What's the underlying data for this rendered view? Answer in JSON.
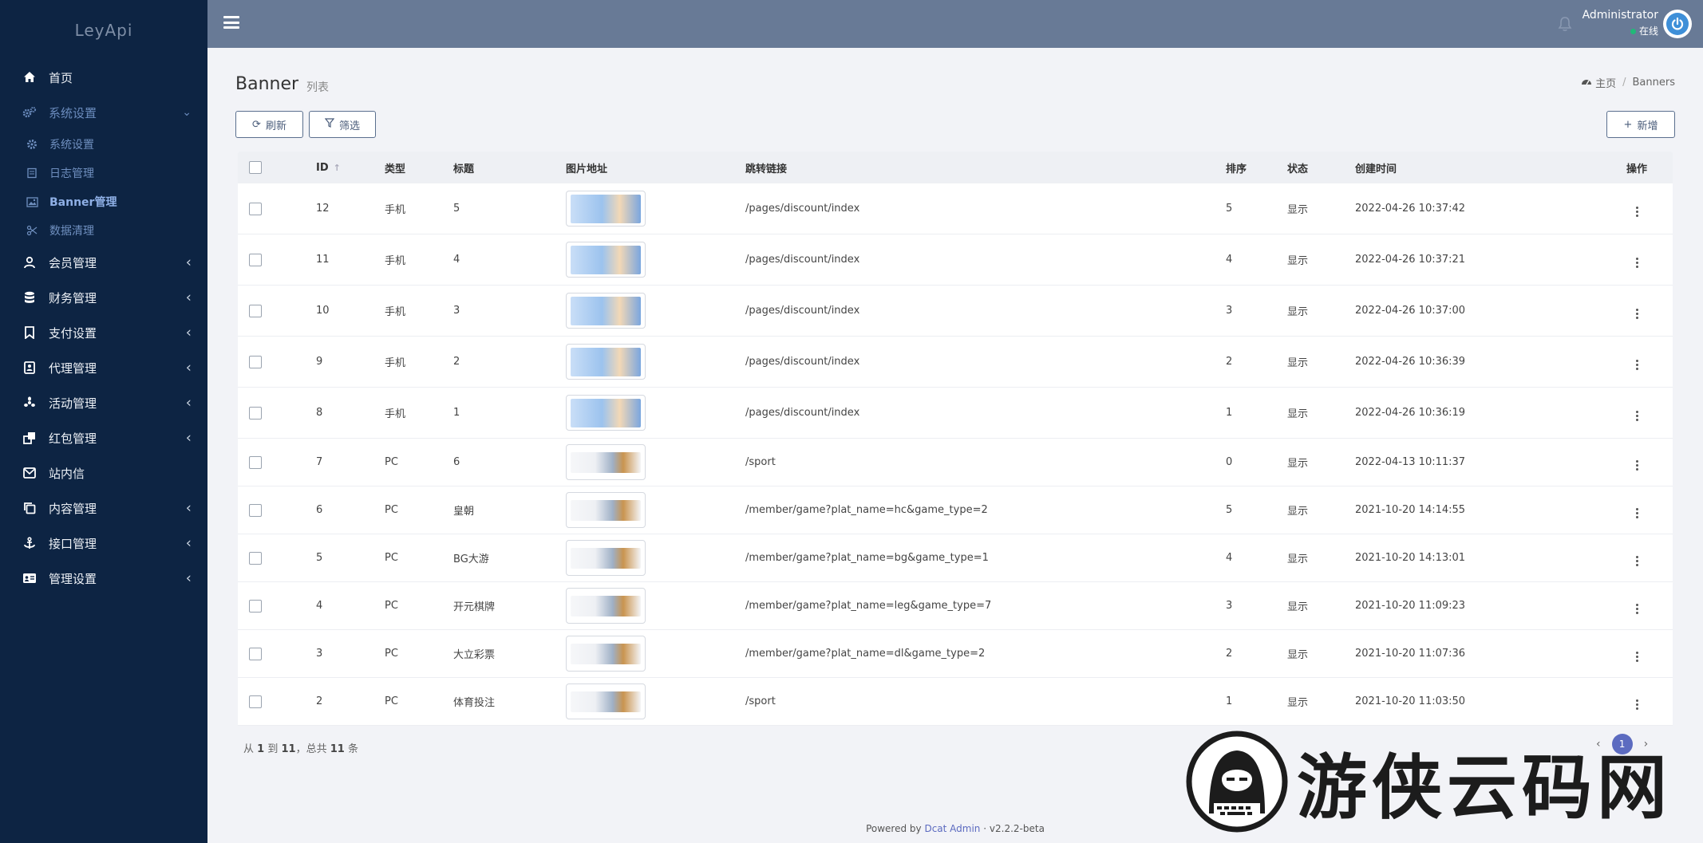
{
  "app": {
    "brand": "LeyApi"
  },
  "sidebar": {
    "items": [
      {
        "label": "首页",
        "icon": "home-icon"
      },
      {
        "label": "系统设置",
        "icon": "cogs-icon",
        "open": true,
        "children": [
          {
            "label": "系统设置",
            "icon": "gear-icon"
          },
          {
            "label": "日志管理",
            "icon": "log-icon"
          },
          {
            "label": "Banner管理",
            "icon": "image-icon",
            "active": true
          },
          {
            "label": "数据清理",
            "icon": "scissors-icon"
          }
        ]
      },
      {
        "label": "会员管理",
        "icon": "user-icon"
      },
      {
        "label": "财务管理",
        "icon": "database-icon"
      },
      {
        "label": "支付设置",
        "icon": "bookmark-icon"
      },
      {
        "label": "代理管理",
        "icon": "agent-icon"
      },
      {
        "label": "活动管理",
        "icon": "activity-icon"
      },
      {
        "label": "红包管理",
        "icon": "redpacket-icon"
      },
      {
        "label": "站内信",
        "icon": "mail-icon"
      },
      {
        "label": "内容管理",
        "icon": "copy-icon"
      },
      {
        "label": "接口管理",
        "icon": "anchor-icon"
      },
      {
        "label": "管理设置",
        "icon": "id-card-icon"
      }
    ]
  },
  "topbar": {
    "user_name": "Administrator",
    "user_status": "在线"
  },
  "page": {
    "title": "Banner",
    "subtitle": "列表",
    "breadcrumb": {
      "home": "主页",
      "current": "Banners"
    }
  },
  "toolbar": {
    "refresh_label": "刷新",
    "filter_label": "筛选",
    "add_label": "新增"
  },
  "table": {
    "columns": [
      "ID",
      "类型",
      "标题",
      "图片地址",
      "跳转链接",
      "排序",
      "状态",
      "创建时间",
      "操作"
    ],
    "rows": [
      {
        "id": "12",
        "type": "手机",
        "title": "5",
        "link": "/pages/discount/index",
        "sort": "5",
        "status": "显示",
        "created": "2022-04-26 10:37:42"
      },
      {
        "id": "11",
        "type": "手机",
        "title": "4",
        "link": "/pages/discount/index",
        "sort": "4",
        "status": "显示",
        "created": "2022-04-26 10:37:21"
      },
      {
        "id": "10",
        "type": "手机",
        "title": "3",
        "link": "/pages/discount/index",
        "sort": "3",
        "status": "显示",
        "created": "2022-04-26 10:37:00"
      },
      {
        "id": "9",
        "type": "手机",
        "title": "2",
        "link": "/pages/discount/index",
        "sort": "2",
        "status": "显示",
        "created": "2022-04-26 10:36:39"
      },
      {
        "id": "8",
        "type": "手机",
        "title": "1",
        "link": "/pages/discount/index",
        "sort": "1",
        "status": "显示",
        "created": "2022-04-26 10:36:19"
      },
      {
        "id": "7",
        "type": "PC",
        "title": "6",
        "link": "/sport",
        "sort": "0",
        "status": "显示",
        "created": "2022-04-13 10:11:37"
      },
      {
        "id": "6",
        "type": "PC",
        "title": "皇朝",
        "link": "/member/game?plat_name=hc&game_type=2",
        "sort": "5",
        "status": "显示",
        "created": "2021-10-20 14:14:55"
      },
      {
        "id": "5",
        "type": "PC",
        "title": "BG大游",
        "link": "/member/game?plat_name=bg&game_type=1",
        "sort": "4",
        "status": "显示",
        "created": "2021-10-20 14:13:01"
      },
      {
        "id": "4",
        "type": "PC",
        "title": "开元棋牌",
        "link": "/member/game?plat_name=leg&game_type=7",
        "sort": "3",
        "status": "显示",
        "created": "2021-10-20 11:09:23"
      },
      {
        "id": "3",
        "type": "PC",
        "title": "大立彩票",
        "link": "/member/game?plat_name=dl&game_type=2",
        "sort": "2",
        "status": "显示",
        "created": "2021-10-20 11:07:36"
      },
      {
        "id": "2",
        "type": "PC",
        "title": "体育投注",
        "link": "/sport",
        "sort": "1",
        "status": "显示",
        "created": "2021-10-20 11:03:50"
      }
    ]
  },
  "summary": {
    "prefix": "从",
    "from": "1",
    "to_word": "到",
    "to": "11",
    "total_word": "，总共",
    "total": "11",
    "unit": "条"
  },
  "pagination": {
    "current": "1"
  },
  "footer": {
    "powered": "Powered by",
    "product": "Dcat Admin",
    "dot": "·",
    "version": "v2.2.2-beta"
  },
  "watermark": {
    "text": "游侠云码网"
  },
  "colors": {
    "sidebar_bg": "#0d2443",
    "topbar_bg": "#687a96",
    "accent": "#5c6bc0",
    "online": "#21b978"
  }
}
